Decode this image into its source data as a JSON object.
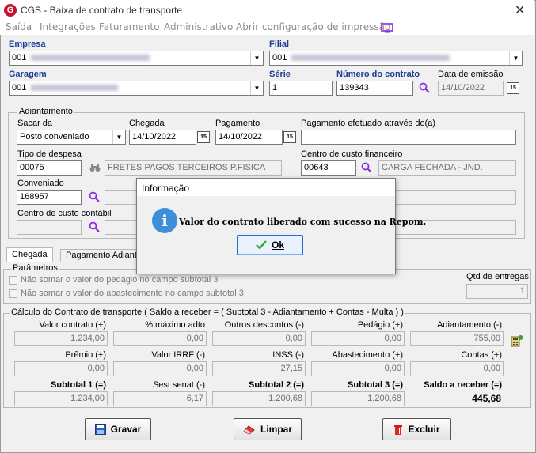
{
  "window": {
    "title": "CGS - Baixa de contrato de transporte",
    "logo_letter": "G",
    "close": "✕"
  },
  "menu": [
    "Saída",
    "Integrações",
    "Faturamento",
    "Administrativo",
    "Abrir configuração de impressão"
  ],
  "header": {
    "empresa_label": "Empresa",
    "empresa_value": "001",
    "filial_label": "Filial",
    "filial_value": "001",
    "garagem_label": "Garagem",
    "garagem_value": "001",
    "serie_label": "Série",
    "serie_value": "1",
    "numero_label": "Número do contrato",
    "numero_value": "139343",
    "emissao_label": "Data de emissão",
    "emissao_value": "14/10/2022"
  },
  "adiantamento": {
    "title": "Adiantamento",
    "sacar_label": "Sacar da",
    "sacar_value": "Posto conveniado",
    "chegada_label": "Chegada",
    "chegada_value": "14/10/2022",
    "pagamento_label": "Pagamento",
    "pagamento_value": "14/10/2022",
    "efetuado_label": "Pagamento efetuado através do(a)",
    "efetuado_value": "",
    "tipo_label": "Tipo de despesa",
    "tipo_code": "00075",
    "tipo_desc": "FRETES PAGOS TERCEIROS P.FISICA",
    "centro_fin_label": "Centro de custo financeiro",
    "centro_fin_code": "00643",
    "centro_fin_desc": "CARGA FECHADA - JND.",
    "conveniado_label": "Conveniado",
    "conveniado_value": "168957",
    "centro_cont_label": "Centro de custo contábil"
  },
  "tabs": [
    "Chegada",
    "Pagamento Adiantam"
  ],
  "parametros": {
    "title": "Parâmetros",
    "opt1": "Não somar o valor do pedágio no campo subtotal 3",
    "opt2": "Não somar o valor do abastecimento no campo subtotal 3",
    "qtd_label": "Qtd de entregas",
    "qtd_value": "1"
  },
  "calculo": {
    "title": "Cálculo do Contrato de transporte ( Saldo a receber = ( Subtotal 3 - Adiantamento + Contas - Multa ) )",
    "row1": [
      {
        "label": "Valor contrato (+)",
        "value": "1.234,00"
      },
      {
        "label": "% máximo adto",
        "value": "0,00"
      },
      {
        "label": "Outros descontos (-)",
        "value": "0,00"
      },
      {
        "label": "Pedágio (+)",
        "value": "0,00"
      },
      {
        "label": "Adiantamento (-)",
        "value": "755,00"
      }
    ],
    "row2": [
      {
        "label": "Prêmio (+)",
        "value": "0,00"
      },
      {
        "label": "Valor IRRF (-)",
        "value": "0,00"
      },
      {
        "label": "INSS (-)",
        "value": "27,15"
      },
      {
        "label": "Abastecimento (+)",
        "value": "0,00"
      },
      {
        "label": "Contas (+)",
        "value": "0,00"
      }
    ],
    "row3": [
      {
        "label": "Subtotal 1 (=)",
        "value": "1.234,00"
      },
      {
        "label": "Sest senat (-)",
        "value": "6,17"
      },
      {
        "label": "Subtotal 2 (=)",
        "value": "1.200,68"
      },
      {
        "label": "Subtotal 3 (=)",
        "value": "1.200,68"
      },
      {
        "label": "Saldo a receber (=)",
        "value": "445,68"
      }
    ]
  },
  "buttons": {
    "gravar": "Gravar",
    "limpar": "Limpar",
    "excluir": "Excluir"
  },
  "dialog": {
    "title": "Informação",
    "message": "Valor do contrato liberado com sucesso na Repom.",
    "ok": "Ok",
    "icon_letter": "i"
  },
  "colors": {
    "label_blue": "#1e3c96",
    "accent": "#3c8fd8",
    "logo_red": "#c8102e"
  }
}
